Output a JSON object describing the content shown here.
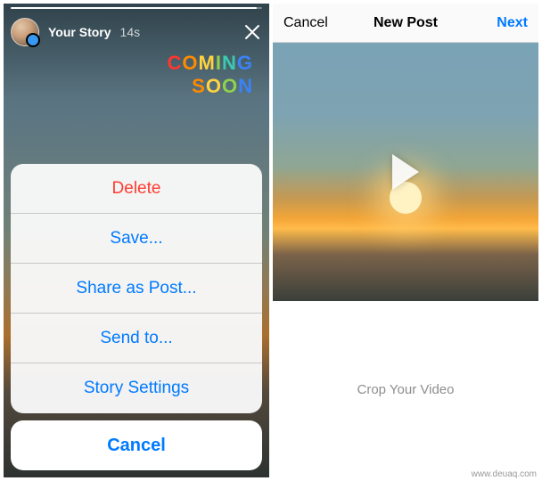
{
  "left": {
    "story_owner": "Your Story",
    "story_time": "14s",
    "sticker_line1": "COMING",
    "sticker_line2": "SOON",
    "sheet": {
      "delete": "Delete",
      "save": "Save...",
      "share_as_post": "Share as Post...",
      "send_to": "Send to...",
      "story_settings": "Story Settings",
      "cancel": "Cancel"
    }
  },
  "right": {
    "nav_cancel": "Cancel",
    "nav_title": "New Post",
    "nav_next": "Next",
    "crop_hint": "Crop Your Video"
  },
  "watermark": "www.deuaq.com"
}
